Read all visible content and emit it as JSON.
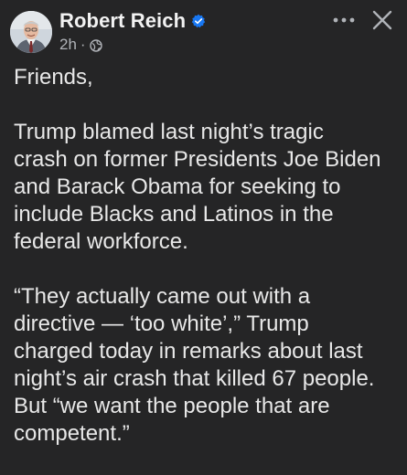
{
  "post": {
    "author": "Robert Reich",
    "timestamp": "2h",
    "separator": "·",
    "audience_icon": "globe-icon",
    "verified_icon": "verified-badge-icon",
    "more_icon": "more-horizontal-icon",
    "close_icon": "close-icon",
    "paragraphs": [
      "Friends,",
      "Trump blamed last night’s tragic\ncrash on former Presidents Joe Biden\nand Barack Obama for seeking to\ninclude Blacks and Latinos in the\nfederal workforce.",
      "“They actually came out with a\ndirective — ‘too white’,” Trump\ncharged today in remarks about last\nnight’s air crash that killed 67 people.\nBut “we want the people that are\ncompetent.”"
    ]
  },
  "colors": {
    "background": "#252526",
    "text": "#e8e8e8",
    "muted": "#b0b3b8",
    "verified": "#1877f2"
  }
}
